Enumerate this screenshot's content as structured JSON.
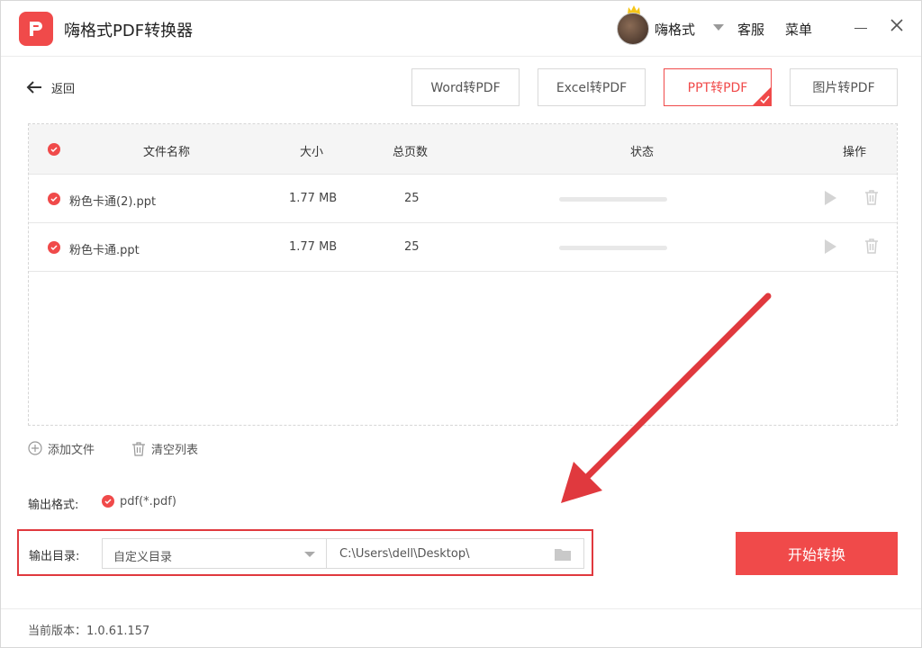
{
  "app": {
    "title": "嗨格式PDF转换器",
    "accent_color": "#f04a4a"
  },
  "header": {
    "username": "嗨格式",
    "service": "客服",
    "menu": "菜单"
  },
  "nav": {
    "back_label": "返回"
  },
  "tabs": [
    {
      "label": "Word转PDF",
      "active": false
    },
    {
      "label": "Excel转PDF",
      "active": false
    },
    {
      "label": "PPT转PDF",
      "active": true
    },
    {
      "label": "图片转PDF",
      "active": false
    }
  ],
  "table": {
    "headers": {
      "name": "文件名称",
      "size": "大小",
      "pages": "总页数",
      "status": "状态",
      "actions": "操作"
    },
    "rows": [
      {
        "name": "粉色卡通(2).ppt",
        "size": "1.77 MB",
        "pages": "25"
      },
      {
        "name": "粉色卡通.ppt",
        "size": "1.77 MB",
        "pages": "25"
      }
    ]
  },
  "list_actions": {
    "add_file": "添加文件",
    "clear_list": "清空列表"
  },
  "output": {
    "format_label": "输出格式:",
    "format_value": "pdf(*.pdf)",
    "dir_label": "输出目录:",
    "dir_option": "自定义目录",
    "dir_path": "C:\\Users\\dell\\Desktop\\"
  },
  "start_button": "开始转换",
  "footer": {
    "version": "当前版本：1.0.61.157"
  }
}
